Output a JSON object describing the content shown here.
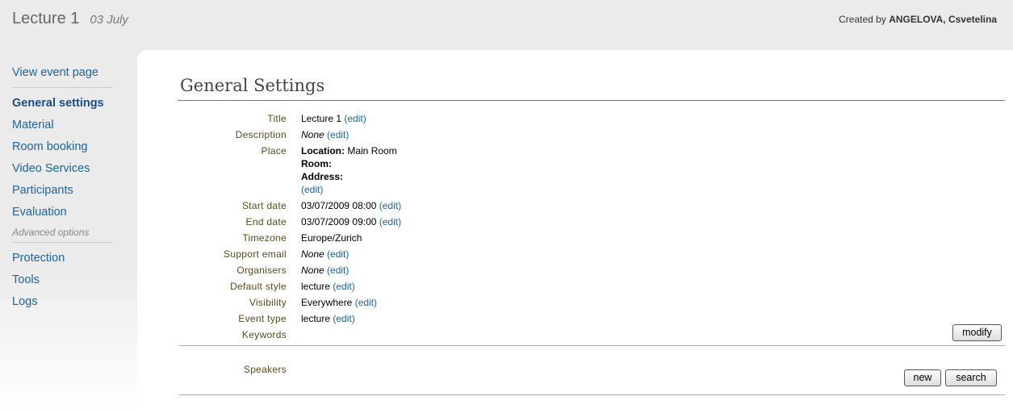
{
  "header": {
    "event_title": "Lecture 1",
    "event_date": "03 July",
    "created_by_prefix": "Created by",
    "created_by_name": "ANGELOVA, Csvetelina"
  },
  "sidebar": {
    "items": [
      {
        "label": "View event page"
      },
      {
        "label": "General settings"
      },
      {
        "label": "Material"
      },
      {
        "label": "Room booking"
      },
      {
        "label": "Video Services"
      },
      {
        "label": "Participants"
      },
      {
        "label": "Evaluation"
      }
    ],
    "advanced_heading": "Advanced options",
    "advanced_items": [
      {
        "label": "Protection"
      },
      {
        "label": "Tools"
      },
      {
        "label": "Logs"
      }
    ]
  },
  "main": {
    "section_title": "General Settings",
    "edit_label": "(edit)",
    "fields": {
      "title": {
        "label": "Title",
        "value": "Lecture 1"
      },
      "description": {
        "label": "Description",
        "value": "None"
      },
      "place": {
        "label": "Place",
        "location_label": "Location:",
        "location_value": "Main Room",
        "room_label": "Room:",
        "address_label": "Address:"
      },
      "start_date": {
        "label": "Start date",
        "value": "03/07/2009 08:00"
      },
      "end_date": {
        "label": "End date",
        "value": "03/07/2009 09:00"
      },
      "timezone": {
        "label": "Timezone",
        "value": "Europe/Zurich"
      },
      "support_email": {
        "label": "Support email",
        "value": "None"
      },
      "organisers": {
        "label": "Organisers",
        "value": "None"
      },
      "default_style": {
        "label": "Default style",
        "value": "lecture"
      },
      "visibility": {
        "label": "Visibility",
        "value": "Everywhere"
      },
      "event_type": {
        "label": "Event type",
        "value": "lecture"
      },
      "keywords": {
        "label": "Keywords"
      }
    },
    "modify_button": "modify",
    "speakers": {
      "label": "Speakers",
      "new_button": "new",
      "search_button": "search"
    }
  }
}
